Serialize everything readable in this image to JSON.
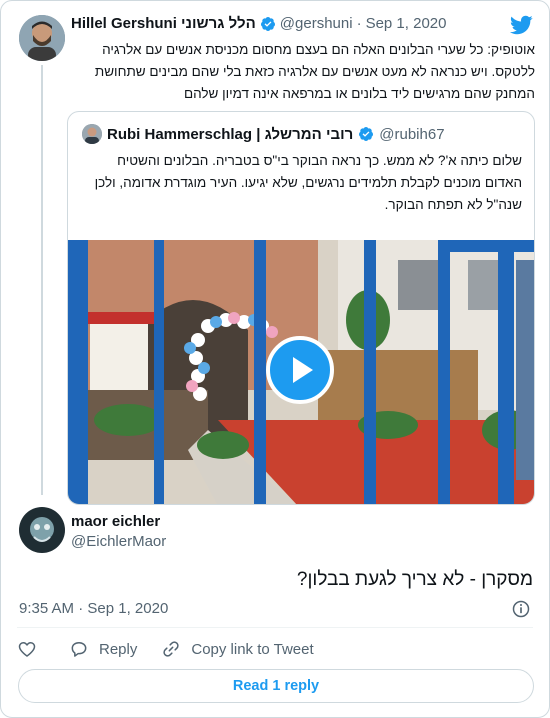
{
  "parent_tweet": {
    "author_name": "Hillel Gershuni הלל גרשוני",
    "handle": "@gershuni",
    "separator": "·",
    "date": "Sep 1, 2020",
    "text": "אוטופיק: כל שערי הבלונים האלה הם בעצם מחסום מכניסת אנשים עם אלרגיה ללטקס. ויש כנראה לא מעט אנשים עם אלרגיה כזאת בלי שהם מבינים שתחושת המחנק שהם מרגישים ליד בלונים או במרפאה אינה דמיון שלהם"
  },
  "quoted_tweet": {
    "author_name": "Rubi Hammerschlag | רובי המרשלג",
    "handle": "@rubih67",
    "text": "שלום כיתה א'? לא ממש. כך נראה הבוקר בי\"ס בטבריה. הבלונים והשטיח האדום מוכנים לקבלת תלמידים נרגשים, שלא יגיעו. העיר מוגדרת אדומה, ולכן שנה\"ל לא תפתח הבוקר.",
    "media_type": "video"
  },
  "reply_tweet": {
    "author_name": "maor eichler",
    "handle": "@EichlerMaor",
    "text": "מסקרן - לא צריך לגעת בבלון?",
    "time": "9:35 AM",
    "separator": "·",
    "date": "Sep 1, 2020"
  },
  "actions": {
    "reply_label": "Reply",
    "copy_link_label": "Copy link to Tweet"
  },
  "read_replies_label": "Read 1 reply",
  "colors": {
    "brand_blue": "#1d9bf0",
    "text_primary": "#0f1419",
    "text_secondary": "#536471",
    "border": "#cfd9de"
  },
  "icons": [
    "twitter-bird-icon",
    "verified-badge-icon",
    "play-icon",
    "info-icon",
    "heart-icon",
    "reply-icon",
    "link-icon"
  ]
}
